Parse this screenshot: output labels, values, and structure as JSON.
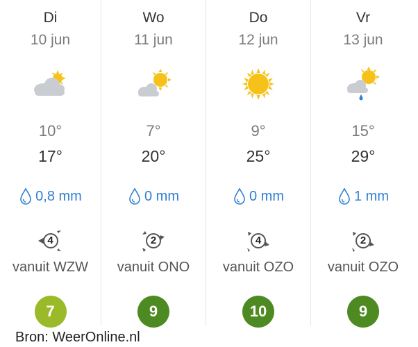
{
  "days": [
    {
      "name": "Di",
      "date": "10 jun",
      "icon": "partly-cloudy-icon",
      "temp_min": "10°",
      "temp_max": "17°",
      "precip": "0,8 mm",
      "wind_force": "4",
      "wind_dir": "vanuit WZW",
      "score": "7",
      "score_color": "#9bba2a"
    },
    {
      "name": "Wo",
      "date": "11 jun",
      "icon": "sun-behind-cloud-icon",
      "temp_min": "7°",
      "temp_max": "20°",
      "precip": "0 mm",
      "wind_force": "2",
      "wind_dir": "vanuit ONO",
      "score": "9",
      "score_color": "#4d8a22"
    },
    {
      "name": "Do",
      "date": "12 jun",
      "icon": "sun-icon",
      "temp_min": "9°",
      "temp_max": "25°",
      "precip": "0 mm",
      "wind_force": "4",
      "wind_dir": "vanuit OZO",
      "score": "10",
      "score_color": "#4d8a22"
    },
    {
      "name": "Vr",
      "date": "13 jun",
      "icon": "sun-cloud-rain-icon",
      "temp_min": "15°",
      "temp_max": "29°",
      "precip": "1 mm",
      "wind_force": "2",
      "wind_dir": "vanuit OZO",
      "score": "9",
      "score_color": "#4d8a22"
    }
  ],
  "source": "Bron: WeerOnline.nl",
  "colors": {
    "sun": "#f6c21a",
    "cloud": "#c9cdd1",
    "rain": "#2f7fd2",
    "divider": "#e4e4e4"
  }
}
